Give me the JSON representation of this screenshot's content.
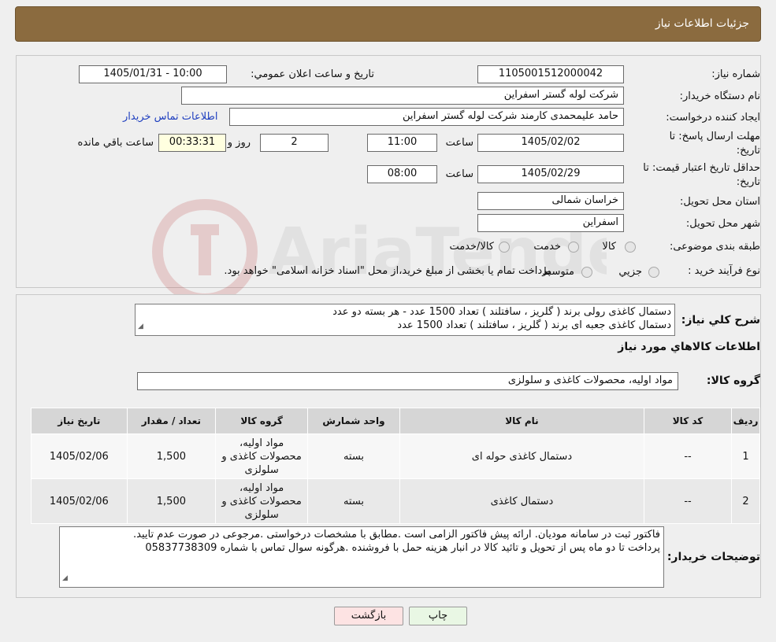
{
  "header": {
    "title": "جزئیات اطلاعات نیاز"
  },
  "watermark": {
    "text": "AriaTender.neT"
  },
  "fields": {
    "need_number_label": "شماره نياز:",
    "need_number": "1105001512000042",
    "announce_label": "تاريخ و ساعت اعلان عمومي:",
    "announce_value": "1405/01/31 - 10:00",
    "buyer_org_label": "نام دستگاه خريدار:",
    "buyer_org": "شرکت لوله گستر اسفراين",
    "creator_label": "ايجاد کننده درخواست:",
    "creator": "حامد علیمحمدی کارمند شرکت لوله گستر اسفراين",
    "contact_link": "اطلاعات تماس خريدار",
    "deadline_label_1": "مهلت ارسال پاسخ: تا",
    "deadline_label_2": "تاريخ:",
    "deadline_date": "1405/02/02",
    "time_label": "ساعت",
    "deadline_time": "11:00",
    "days_value": "2",
    "days_label": "روز و",
    "remaining_time": "00:33:31",
    "remaining_label": "ساعت باقي مانده",
    "validity_label_1": "حداقل تاريخ اعتبار قيمت: تا",
    "validity_label_2": "تاريخ:",
    "validity_date": "1405/02/29",
    "validity_time": "08:00",
    "province_label": "استان محل تحويل:",
    "province": "خراسان شمالی",
    "city_label": "شهر محل تحويل:",
    "city": "اسفراين",
    "category_label": "طبقه بندی موضوعی:",
    "category_options": [
      "کالا",
      "خدمت",
      "کالا/خدمت"
    ],
    "process_label": "نوع فرآيند خريد :",
    "process_options": [
      "جزيي",
      "متوسط"
    ],
    "process_note": "پرداخت تمام يا بخشی از مبلغ خريد،از محل \"اسناد خزانه اسلامی\" خواهد بود."
  },
  "summary": {
    "label": "شرح کلي نياز:",
    "lines": [
      "دستمال کاغذی رولی برند ( گلریز ، سافتلند ) تعداد 1500 عدد - هر بسته دو عدد",
      "دستمال کاغذی جعبه ای برند ( گلریز ، سافتلند ) تعداد 1500 عدد"
    ]
  },
  "goods": {
    "section_title": "اطلاعات کالاهاي مورد نياز",
    "group_label": "گروه کالا:",
    "group_value": "مواد اولیه، محصولات کاغذی و سلولزی"
  },
  "table": {
    "headers": [
      "رديف",
      "کد کالا",
      "نام کالا",
      "واحد شمارش",
      "گروه کالا",
      "تعداد / مقدار",
      "تاريخ نياز"
    ],
    "rows": [
      {
        "row": "1",
        "code": "--",
        "name": "دستمال کاغذی حوله ای",
        "unit": "بسته",
        "group_l1": "مواد اولیه،",
        "group_l2": "محصولات کاغذی و",
        "group_l3": "سلولزی",
        "qty": "1,500",
        "date": "1405/02/06"
      },
      {
        "row": "2",
        "code": "--",
        "name": "دستمال کاغذی",
        "unit": "بسته",
        "group_l1": "مواد اولیه،",
        "group_l2": "محصولات کاغذی و",
        "group_l3": "سلولزی",
        "qty": "1,500",
        "date": "1405/02/06"
      }
    ]
  },
  "notes": {
    "label": "توضيحات خريدار:",
    "lines": [
      "فاکتور ثبت در سامانه مودیان. ارائه پیش فاکتور الزامی است .مطابق با مشخصات درخواستی .مرجوعی در صورت عدم تایید.",
      "پرداخت تا دو ماه پس از تحویل و تائید کالا در انبار  هزینه حمل با فروشنده .هرگونه سوال تماس با شماره 05837738309"
    ]
  },
  "buttons": {
    "print": "چاپ",
    "back": "بازگشت"
  },
  "colors": {
    "header_bg": "#8b6b3f",
    "back_button_bg": "#fde3e3",
    "print_button_bg": "#e9f7e4",
    "link": "#1f3fbf"
  }
}
